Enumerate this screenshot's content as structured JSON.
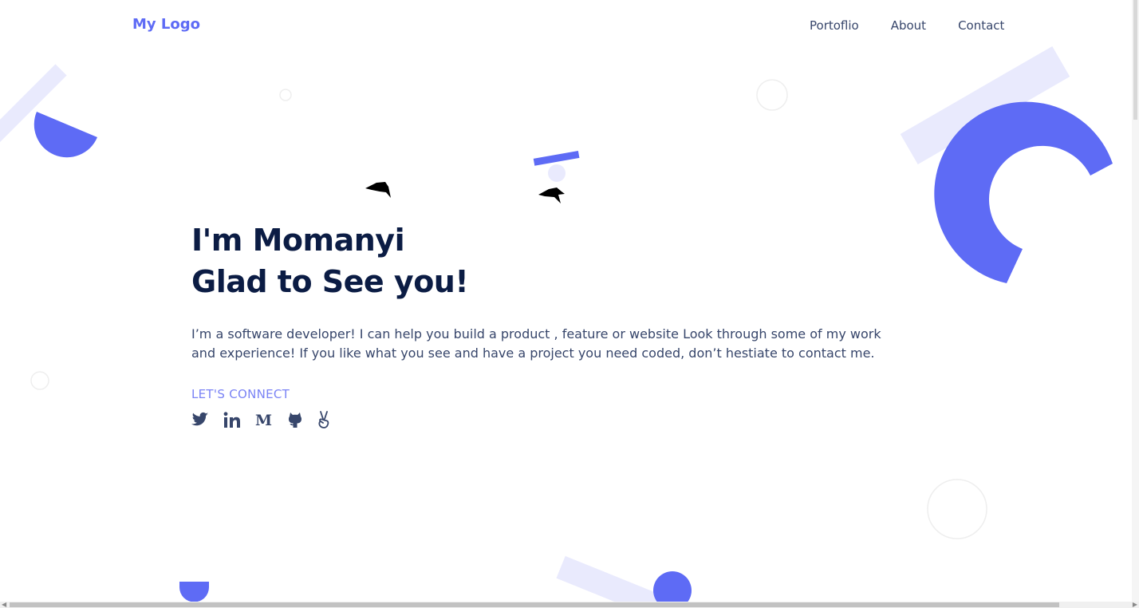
{
  "header": {
    "logo": "My Logo",
    "nav": [
      {
        "label": "Portoflio"
      },
      {
        "label": "About"
      },
      {
        "label": "Contact"
      }
    ]
  },
  "hero": {
    "title_line1": "I'm Momanyi",
    "title_line2": "Glad to See you!",
    "description": "I’m a software developer! I can help you build a product , feature or website Look through some of my work and experience! If you like what you see and have a project you need coded, don’t hestiate to contact me.",
    "connect_label": "LET'S CONNECT",
    "social_icons": [
      "twitter-icon",
      "linkedin-icon",
      "medium-icon",
      "github-icon",
      "angellist-icon"
    ]
  },
  "colors": {
    "accent": "#5e6bf5",
    "accent_light": "#e9eafd",
    "heading": "#0b1c44",
    "body_text": "#37466b",
    "connect": "#7a83f5"
  }
}
